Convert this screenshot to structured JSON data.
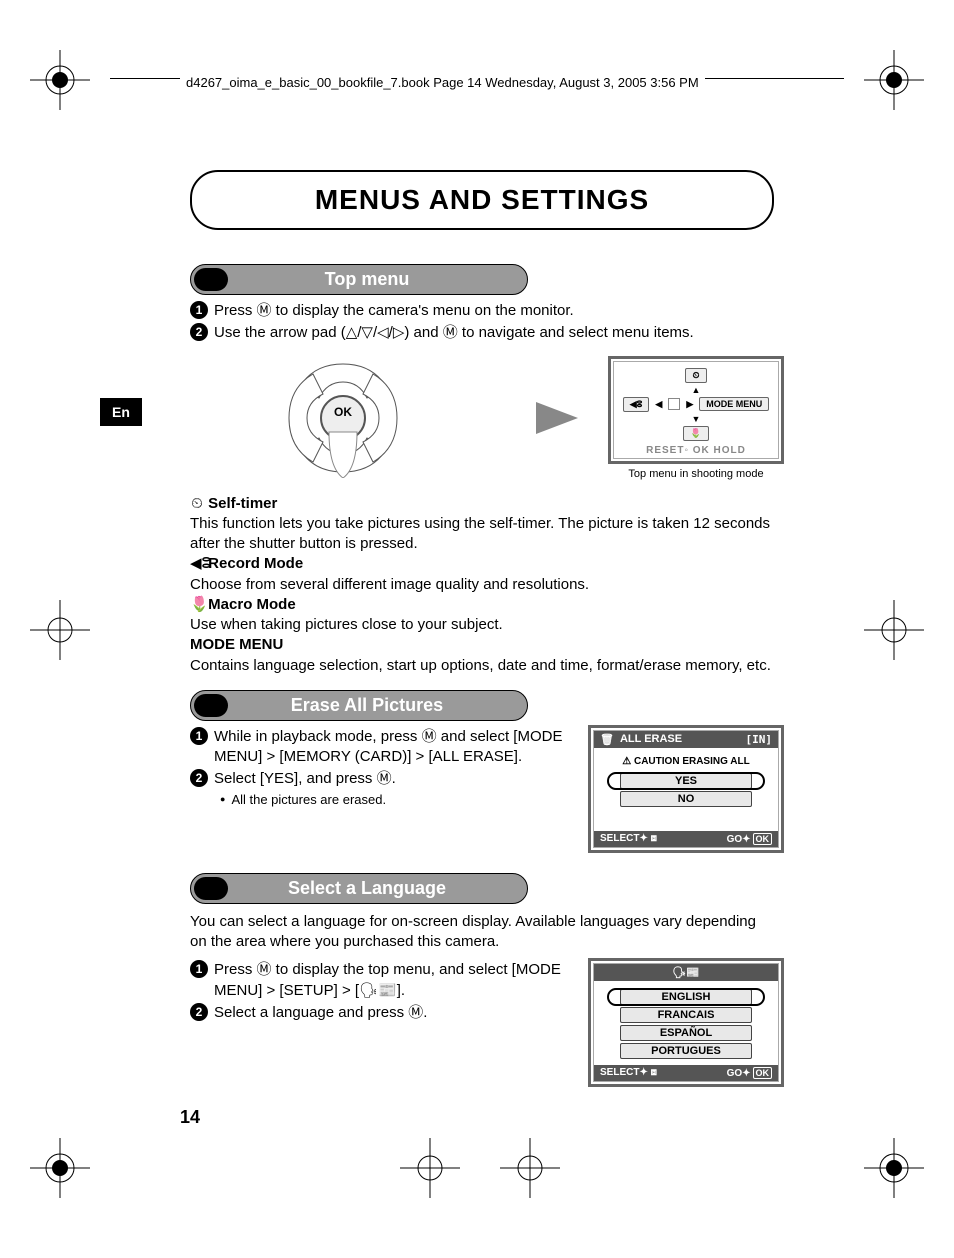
{
  "meta": {
    "book_header": "d4267_oima_e_basic_00_bookfile_7.book  Page 14  Wednesday, August 3, 2005  3:56 PM",
    "lang_tab": "En",
    "page_number": "14"
  },
  "title": "MENUS AND SETTINGS",
  "sections": {
    "top_menu": {
      "heading": "Top menu",
      "step1": "Press Ⓜ to display the camera's menu on the monitor.",
      "step2": "Use the arrow pad (△/▽/◁/▷) and Ⓜ to navigate and select menu items.",
      "lcd": {
        "quality_label": "◀ⵓ",
        "mode_menu": "MODE MENU",
        "footer": "RESET◦  OK  HOLD",
        "caption": "Top menu in shooting mode"
      },
      "defs": {
        "self_timer_t": "Self-timer",
        "self_timer_d": "This function lets you take pictures using the self-timer. The picture is taken 12 seconds after the shutter button is pressed.",
        "record_t": "Record Mode",
        "record_d": "Choose from several different image quality and resolutions.",
        "macro_t": "Macro Mode",
        "macro_d": "Use when taking pictures close to your subject.",
        "mode_menu_t": "MODE MENU",
        "mode_menu_d": "Contains language selection, start up options, date and time, format/erase memory, etc."
      }
    },
    "erase": {
      "heading": "Erase All Pictures",
      "step1": "While in playback mode, press Ⓜ and select [MODE MENU] > [MEMORY (CARD)] > [ALL ERASE].",
      "step2": "Select [YES], and press Ⓜ.",
      "bullet": "All the pictures are erased.",
      "lcd": {
        "title_icon": "🗑",
        "title": "ALL ERASE",
        "title_badge": "[IN]",
        "caution": "⚠ CAUTION ERASING ALL",
        "yes": "YES",
        "no": "NO",
        "select": "SELECT✦",
        "go": "GO✦"
      }
    },
    "language": {
      "heading": "Select a Language",
      "intro": "You can select a language for on-screen display. Available languages vary depending on the area where you purchased this camera.",
      "step1": "Press Ⓜ to display the top menu, and select [MODE MENU] > [SETUP] > [🗣📰].",
      "step2": "Select a language and press Ⓜ.",
      "lcd": {
        "title_icon": "🗣📰",
        "opts": [
          "ENGLISH",
          "FRANCAIS",
          "ESPAÑOL",
          "PORTUGUES"
        ],
        "select": "SELECT✦",
        "go": "GO✦"
      }
    }
  }
}
